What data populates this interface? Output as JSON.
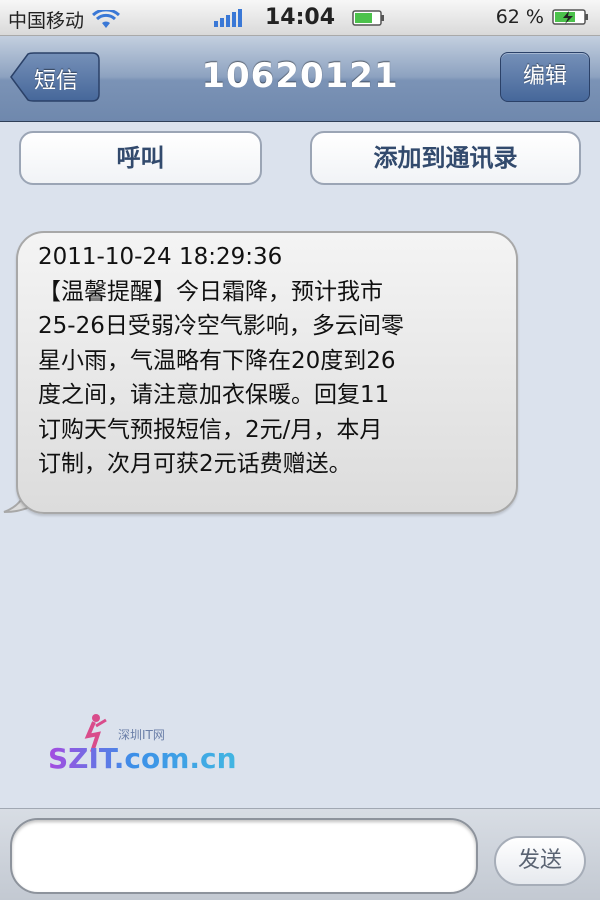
{
  "status_bar": {
    "carrier": "中国移动",
    "time": "14:04",
    "battery_percent": "62 %",
    "icons": [
      "wifi-icon",
      "signal-bars-icon",
      "battery-icon",
      "charging-battery-icon"
    ]
  },
  "nav": {
    "back_label": "短信",
    "title": "10620121",
    "edit_label": "编辑"
  },
  "actions": {
    "call_label": "呼叫",
    "add_contact_label": "添加到通讯录"
  },
  "message": {
    "lines": [
      "2011-10-24 18:29:36",
      "【温馨提醒】今日霜降，预计我市",
      "25-26日受弱冷空气影响，多云间零",
      "星小雨，气温略有下降在20度到26",
      "度之间，请注意加衣保暖。回复11",
      "订购天气预报短信，2元/月，本月",
      "订制，次月可获2元话费赠送。"
    ]
  },
  "watermark": {
    "name": "SZIT.com.cn",
    "subtitle": "深圳IT网"
  },
  "input": {
    "value": "",
    "send_label": "发送"
  },
  "colors": {
    "background": "#dbe2ed",
    "nav_blue": "#6f88ad",
    "button_text": "#324a6d"
  }
}
